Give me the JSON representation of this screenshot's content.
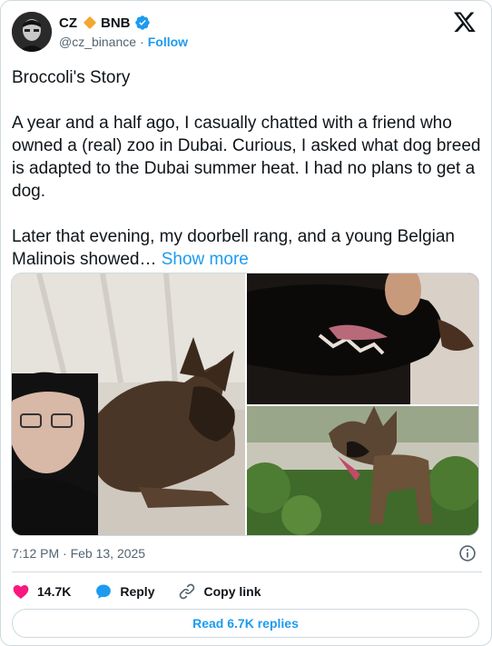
{
  "author": {
    "name": "CZ",
    "badge_text": "BNB",
    "handle": "@cz_binance",
    "separator": "·",
    "follow_label": "Follow"
  },
  "tweet": {
    "paragraph_1": "Broccoli's Story",
    "paragraph_2": "A year and a half ago, I casually chatted with a friend who owned a (real) zoo in Dubai. Curious, I asked what dog breed is adapted to the Dubai summer heat. I had no plans to get a dog.",
    "paragraph_3": "Later that evening, my doorbell rang, and a young Belgian Malinois showed…",
    "show_more_label": "Show more"
  },
  "meta": {
    "timestamp": "7:12 PM · Feb 13, 2025"
  },
  "actions": {
    "likes": "14.7K",
    "reply_label": "Reply",
    "copy_link_label": "Copy link"
  },
  "read_replies_label": "Read 6.7K replies",
  "icons": {
    "like": "heart-icon",
    "reply": "reply-bubble-icon",
    "copy": "link-icon",
    "info": "info-icon",
    "logo": "x-logo-icon",
    "verified": "verified-badge-icon",
    "affiliate": "bnb-diamond-icon"
  },
  "colors": {
    "accent": "#1d9bf0",
    "heart": "#f91880",
    "bnb": "#f3a72f",
    "text": "#0f1419",
    "secondary": "#536471"
  }
}
